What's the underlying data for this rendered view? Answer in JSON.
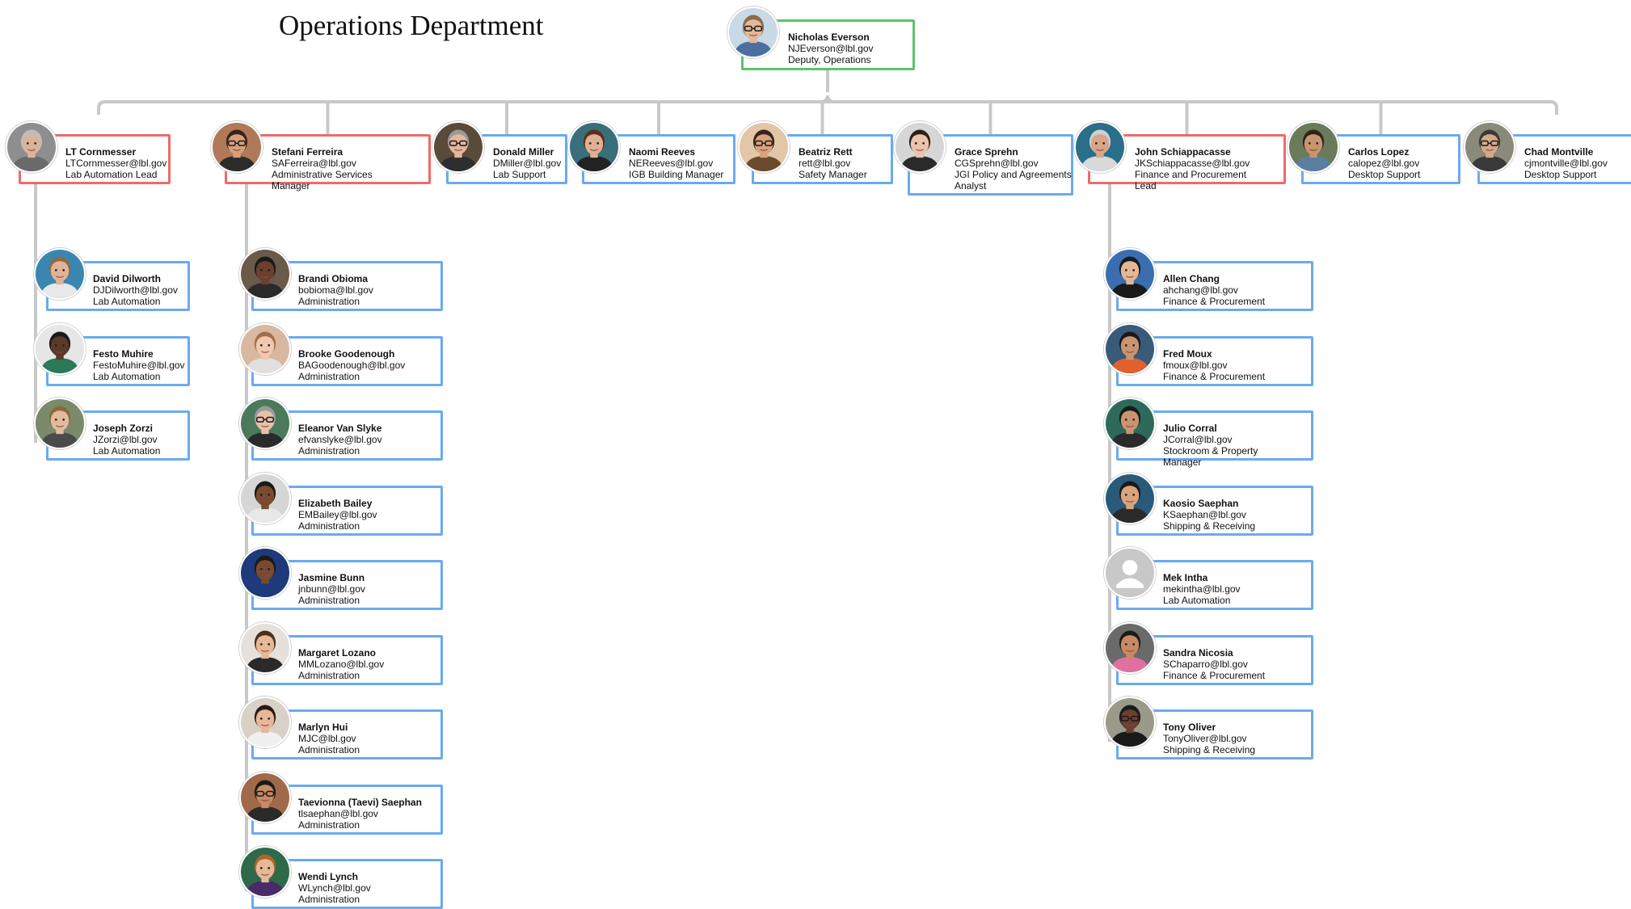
{
  "title": "Operations Department",
  "head": {
    "name": "Nicholas Everson",
    "email": "NJEverson@lbl.gov",
    "role": "Deputy, Operations",
    "photo": {
      "bg": "#c9d9e6",
      "skin": "#e6b89a",
      "hair": "#8a6a4a",
      "shirt": "#4a6fa0",
      "glasses": true
    }
  },
  "level1": [
    {
      "name": "LT Cornmesser",
      "email": "LTCornmesser@lbl.gov",
      "role": "Lab Automation Lead",
      "lead": true,
      "photo": {
        "bg": "#8e8e8e",
        "skin": "#d9b39a",
        "hair": "#bdbdbd",
        "shirt": "#6a6a6a"
      }
    },
    {
      "name": "Stefani Ferreira",
      "email": "SAFerreira@lbl.gov",
      "role": "Administrative Services Manager",
      "lead": true,
      "photo": {
        "bg": "#b07a5a",
        "skin": "#d6a07c",
        "hair": "#3a2418",
        "shirt": "#2c2c2c",
        "glasses": true
      }
    },
    {
      "name": "Donald Miller",
      "email": "DMiller@lbl.gov",
      "role": "Lab Support",
      "photo": {
        "bg": "#5a4a3a",
        "skin": "#e2b79c",
        "hair": "#9a9a9a",
        "shirt": "#2e2e2e",
        "glasses": true
      }
    },
    {
      "name": "Naomi Reeves",
      "email": "NEReeves@lbl.gov",
      "role": "IGB Building Manager",
      "photo": {
        "bg": "#3a6e7a",
        "skin": "#e0b092",
        "hair": "#5a2e1e",
        "shirt": "#222222"
      }
    },
    {
      "name": "Beatriz Rett",
      "email": "rett@lbl.gov",
      "role": "Safety Manager",
      "photo": {
        "bg": "#e3c6a8",
        "skin": "#d8a37e",
        "hair": "#3a2418",
        "shirt": "#6b4a2e",
        "glasses": true
      }
    },
    {
      "name": "Grace Sprehn",
      "email": "CGSprehn@lbl.gov",
      "role": "JGI Policy and Agreements Analyst",
      "photo": {
        "bg": "#d6d6d6",
        "skin": "#e9c3ab",
        "hair": "#2e2018",
        "shirt": "#2a2a2a"
      }
    },
    {
      "name": "John Schiappacasse",
      "email": "JKSchiappacasse@lbl.gov",
      "role": "Finance and Procurement Lead",
      "lead": true,
      "photo": {
        "bg": "#2a6e8a",
        "skin": "#d9a58a",
        "hair": "#cfcfcf",
        "shirt": "#d9d9d9"
      }
    },
    {
      "name": "Carlos Lopez",
      "email": "calopez@lbl.gov",
      "role": "Desktop Support",
      "photo": {
        "bg": "#6a7a5a",
        "skin": "#c99470",
        "hair": "#2e2418",
        "shirt": "#5a7fa0"
      }
    },
    {
      "name": "Chad Montville",
      "email": "cjmontville@lbl.gov",
      "role": "Desktop Support",
      "photo": {
        "bg": "#8a8a7a",
        "skin": "#d4a98a",
        "hair": "#3a3a3a",
        "shirt": "#3a3a3a",
        "glasses": true
      }
    }
  ],
  "groups": {
    "cornmesser": [
      {
        "name": "David Dilworth",
        "email": "DJDilworth@lbl.gov",
        "role": "Lab Automation",
        "photo": {
          "bg": "#3a86b0",
          "skin": "#e2b297",
          "hair": "#8a6a4a",
          "shirt": "#e8e8e8"
        }
      },
      {
        "name": "Festo Muhire",
        "email": "FestoMuhire@lbl.gov",
        "role": "Lab Automation",
        "photo": {
          "bg": "#e6e6e6",
          "skin": "#5a3a2a",
          "hair": "#1a1a1a",
          "shirt": "#2a7a5a"
        }
      },
      {
        "name": "Joseph Zorzi",
        "email": "JZorzi@lbl.gov",
        "role": "Lab Automation",
        "photo": {
          "bg": "#7a8a6a",
          "skin": "#e2bb9e",
          "hair": "#8a6a3a",
          "shirt": "#4a4a4a"
        }
      }
    ],
    "ferreira": [
      {
        "name": "Brandi Obioma",
        "email": "bobioma@lbl.gov",
        "role": "Administration",
        "photo": {
          "bg": "#6a5a4a",
          "skin": "#6a4030",
          "hair": "#1a1a1a",
          "shirt": "#2a2a2a"
        }
      },
      {
        "name": "Brooke Goodenough",
        "email": "BAGoodenough@lbl.gov",
        "role": "Administration",
        "photo": {
          "bg": "#d9b8a0",
          "skin": "#efc8ae",
          "hair": "#a0704a",
          "shirt": "#e0e0e0"
        }
      },
      {
        "name": "Eleanor Van Slyke",
        "email": "efvanslyke@lbl.gov",
        "role": "Administration",
        "photo": {
          "bg": "#4a7a5a",
          "skin": "#e8c2a8",
          "hair": "#9a9a9a",
          "shirt": "#2a2a2a",
          "glasses": true
        }
      },
      {
        "name": "Elizabeth Bailey",
        "email": "EMBailey@lbl.gov",
        "role": "Administration",
        "photo": {
          "bg": "#d6d6d6",
          "skin": "#7a4a32",
          "hair": "#1a1a1a",
          "shirt": "#e8e8e8"
        }
      },
      {
        "name": "Jasmine Bunn",
        "email": "jnbunn@lbl.gov",
        "role": "Administration",
        "photo": {
          "bg": "#1e3a7a",
          "skin": "#7a4a32",
          "hair": "#1a1a1a",
          "shirt": "#1e3a7a"
        }
      },
      {
        "name": "Margaret Lozano",
        "email": "MMLozano@lbl.gov",
        "role": "Administration",
        "photo": {
          "bg": "#e6e0da",
          "skin": "#e6b898",
          "hair": "#4a2e1e",
          "shirt": "#2a2a2a"
        }
      },
      {
        "name": "Marlyn Hui",
        "email": "MJC@lbl.gov",
        "role": "Administration",
        "photo": {
          "bg": "#d9d0c6",
          "skin": "#e6b898",
          "hair": "#2a1a12",
          "shirt": "#f0f0f0"
        }
      },
      {
        "name": "Taevionna (Taevi) Saephan",
        "email": "tlsaephan@lbl.gov",
        "role": "Administration",
        "photo": {
          "bg": "#a06a4a",
          "skin": "#c88a64",
          "hair": "#1a1a1a",
          "shirt": "#2a2a2a",
          "glasses": true
        }
      },
      {
        "name": "Wendi Lynch",
        "email": "WLynch@lbl.gov",
        "role": "Administration",
        "photo": {
          "bg": "#2e6a4a",
          "skin": "#e6b898",
          "hair": "#b0642e",
          "shirt": "#4a2a6a"
        }
      }
    ],
    "schiappacasse": [
      {
        "name": "Allen Chang",
        "email": "ahchang@lbl.gov",
        "role": "Finance & Procurement",
        "photo": {
          "bg": "#3a6eb0",
          "skin": "#e2b894",
          "hair": "#1a1a1a",
          "shirt": "#1a1a1a"
        }
      },
      {
        "name": "Fred Moux",
        "email": "fmoux@lbl.gov",
        "role": "Finance & Procurement",
        "photo": {
          "bg": "#3a5a7a",
          "skin": "#c99470",
          "hair": "#1a1a1a",
          "shirt": "#e0602e"
        }
      },
      {
        "name": "Julio Corral",
        "email": "JCorral@lbl.gov",
        "role": "Stockroom & Property Manager",
        "photo": {
          "bg": "#2e6a5a",
          "skin": "#c99470",
          "hair": "#1a1a1a",
          "shirt": "#2a2a2a"
        }
      },
      {
        "name": "Kaosio Saephan",
        "email": "KSaephan@lbl.gov",
        "role": "Shipping & Receiving",
        "photo": {
          "bg": "#2a5a7a",
          "skin": "#d9a47c",
          "hair": "#1a1a1a",
          "shirt": "#2a2a2a"
        }
      },
      {
        "name": "Mek Intha",
        "email": "mekintha@lbl.gov",
        "role": "Lab Automation",
        "photo": {
          "placeholder": true,
          "bg": "#c8c8c8",
          "skin": "#ffffff",
          "hair": "#ffffff",
          "shirt": "#ffffff"
        }
      },
      {
        "name": "Sandra Nicosia",
        "email": "SChaparro@lbl.gov",
        "role": "Finance & Procurement",
        "photo": {
          "bg": "#6a6a6a",
          "skin": "#c88a64",
          "hair": "#1a1a1a",
          "shirt": "#e070a0"
        }
      },
      {
        "name": "Tony Oliver",
        "email": "TonyOliver@lbl.gov",
        "role": "Shipping & Receiving",
        "photo": {
          "bg": "#9a9a8a",
          "skin": "#6a4030",
          "hair": "#1a1a1a",
          "shirt": "#1a1a1a",
          "glasses": true
        }
      }
    ]
  },
  "colors": {
    "lead": "#ec6b6b",
    "head": "#5dc36a",
    "member": "#6aaaf0",
    "connector": "#c8c8c8"
  }
}
